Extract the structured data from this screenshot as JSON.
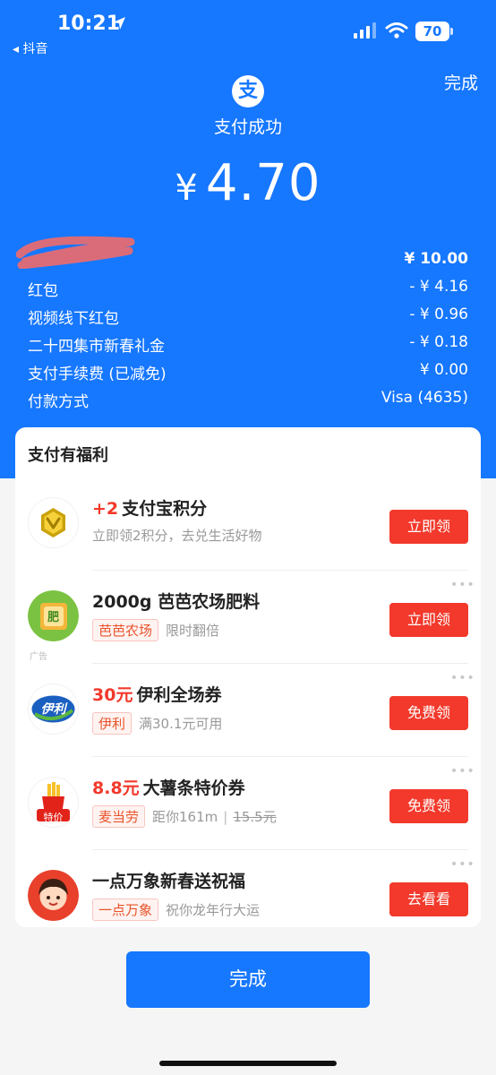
{
  "status_bar": {
    "time": "10:21",
    "back_app": "◂ 抖音",
    "battery": "70"
  },
  "header": {
    "done_link": "完成",
    "logo_char": "支",
    "status": "支付成功",
    "currency": "¥",
    "amount": "4.70"
  },
  "details": [
    {
      "label": "",
      "value": "¥ 10.00"
    },
    {
      "label": "红包",
      "value": "- ¥ 4.16"
    },
    {
      "label": "视频线下红包",
      "value": "- ¥ 0.96"
    },
    {
      "label": "二十四集市新春礼金",
      "value": "- ¥ 0.18"
    },
    {
      "label": "支付手续费 (已减免)",
      "value": "¥ 0.00"
    },
    {
      "label": "付款方式",
      "value": "Visa (4635)"
    }
  ],
  "benefits": {
    "title": "支付有福利",
    "offers": [
      {
        "highlight": "+2",
        "title": "支付宝积分",
        "subtitle": "立即领2积分，去兑生活好物",
        "button": "立即领"
      },
      {
        "highlight": "",
        "title": "2000g 芭芭农场肥料",
        "tag": "芭芭农场",
        "subtitle": "限时翻倍",
        "button": "立即领",
        "ad_label": "广告",
        "logo_text": "肥"
      },
      {
        "highlight": "30元",
        "title": "伊利全场券",
        "tag": "伊利",
        "subtitle": "满30.1元可用",
        "button": "免费领",
        "logo_text": "伊利"
      },
      {
        "highlight": "8.8元",
        "title": "大薯条特价券",
        "tag": "麦当劳",
        "subtitle": "距你161m",
        "original_price": "15.5元",
        "button": "免费领",
        "logo_text": "特价"
      },
      {
        "highlight": "",
        "title": "一点万象新春送祝福",
        "tag": "一点万象",
        "subtitle": "祝你龙年行大运",
        "button": "去看看"
      }
    ],
    "more_glyph": "•••"
  },
  "footer": {
    "done_button": "完成"
  },
  "colors": {
    "brand_blue": "#1677ff",
    "accent_red": "#f2392b",
    "page_bg": "#f5f5f5"
  }
}
